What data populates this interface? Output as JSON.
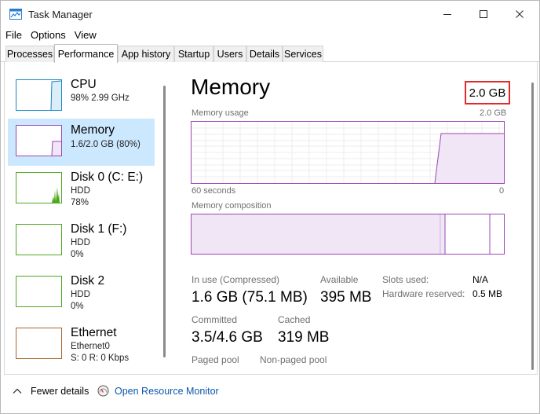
{
  "window": {
    "title": "Task Manager",
    "accent": "#9b45b5"
  },
  "menu": [
    {
      "label": "File"
    },
    {
      "label": "Options"
    },
    {
      "label": "View"
    }
  ],
  "tabs": [
    {
      "label": "Processes"
    },
    {
      "label": "Performance",
      "active": true
    },
    {
      "label": "App history"
    },
    {
      "label": "Startup"
    },
    {
      "label": "Users"
    },
    {
      "label": "Details"
    },
    {
      "label": "Services"
    }
  ],
  "sidebar": {
    "items": [
      {
        "name": "CPU",
        "line1": "98%  2.99 GHz",
        "line2": "",
        "color": "#1889c9"
      },
      {
        "name": "Memory",
        "line1": "1.6/2.0 GB (80%)",
        "line2": "",
        "color": "#9b45b5",
        "selected": true
      },
      {
        "name": "Disk 0 (C: E:)",
        "line1": "HDD",
        "line2": "78%",
        "color": "#4da81f"
      },
      {
        "name": "Disk 1 (F:)",
        "line1": "HDD",
        "line2": "0%",
        "color": "#4da81f"
      },
      {
        "name": "Disk 2",
        "line1": "HDD",
        "line2": "0%",
        "color": "#4da81f"
      },
      {
        "name": "Ethernet",
        "line1": "Ethernet0",
        "line2": "S: 0  R: 0 Kbps",
        "color": "#a7652e"
      }
    ]
  },
  "detail": {
    "title": "Memory",
    "total": "2.0 GB",
    "usage_label": "Memory usage",
    "usage_max": "2.0 GB",
    "time_left": "60 seconds",
    "time_right": "0",
    "composition_label": "Memory composition",
    "stats": {
      "in_use_label": "In use (Compressed)",
      "in_use_value": "1.6 GB (75.1 MB)",
      "available_label": "Available",
      "available_value": "395 MB",
      "committed_label": "Committed",
      "committed_value": "3.5/4.6 GB",
      "cached_label": "Cached",
      "cached_value": "319 MB",
      "paged_label": "Paged pool",
      "nonpaged_label": "Non-paged pool"
    },
    "right_stats": {
      "slots_label": "Slots used:",
      "slots_value": "N/A",
      "hw_label": "Hardware reserved:",
      "hw_value": "0.5 MB"
    }
  },
  "footer": {
    "fewer_details": "Fewer details",
    "open_resource_monitor": "Open Resource Monitor"
  }
}
